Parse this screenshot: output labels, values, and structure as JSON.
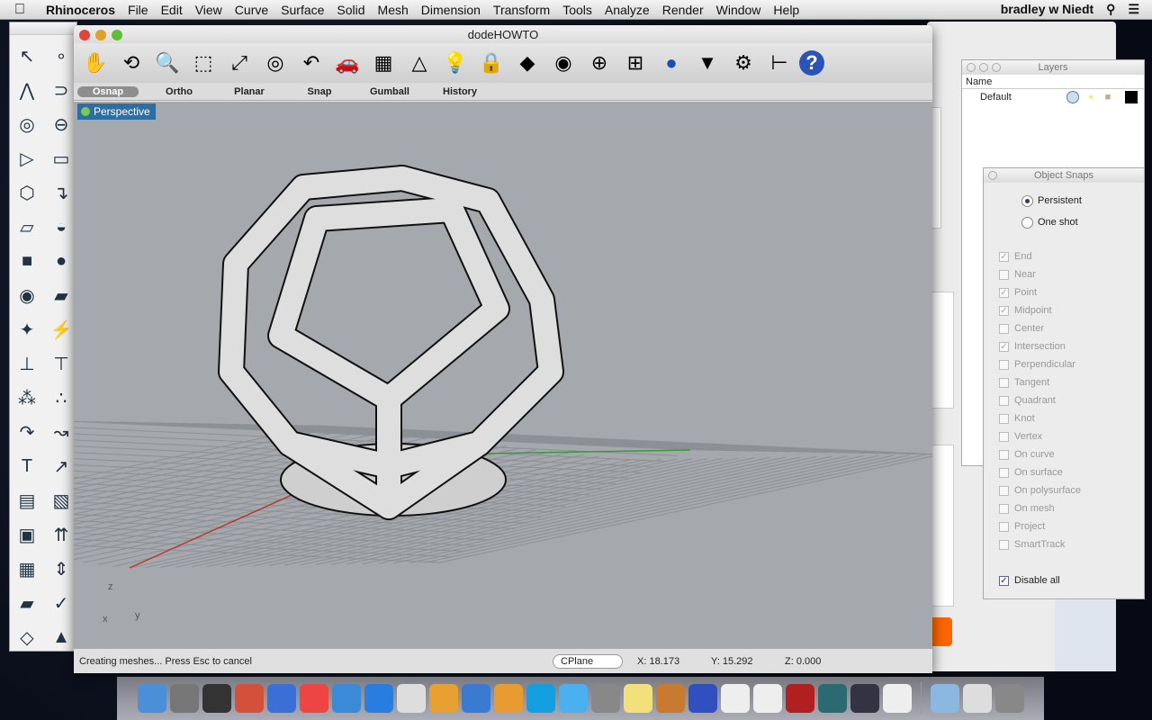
{
  "menubar": {
    "app": "Rhinoceros",
    "items": [
      "File",
      "Edit",
      "View",
      "Curve",
      "Surface",
      "Solid",
      "Mesh",
      "Dimension",
      "Transform",
      "Tools",
      "Analyze",
      "Render",
      "Window",
      "Help"
    ],
    "user": "bradley w Niedt"
  },
  "window": {
    "title": "dodeHOWTO"
  },
  "toolbar": {
    "icons": [
      "pan-hand-icon",
      "rotate-view-icon",
      "zoom-dynamic-icon",
      "zoom-window-icon",
      "zoom-extents-icon",
      "zoom-selected-icon",
      "undo-view-icon",
      "named-view-car-icon",
      "cplane-icon",
      "shapes-icon",
      "light-icon",
      "lock-icon",
      "layer-icon",
      "color-wheel-icon",
      "wireframe-sphere-icon",
      "grid-sphere-icon",
      "shaded-sphere-icon",
      "render-cone-icon",
      "gear-options-icon",
      "dimension-icon",
      "help-icon"
    ]
  },
  "modes": {
    "items": [
      "Osnap",
      "Ortho",
      "Planar",
      "Snap",
      "Gumball",
      "History"
    ],
    "active": "Osnap"
  },
  "viewport": {
    "name": "Perspective",
    "axis_z": "z",
    "axis_x": "x",
    "axis_y": "y"
  },
  "status": {
    "message": "Creating meshes... Press Esc to cancel",
    "cplane": "CPlane",
    "x": "X: 18.173",
    "y": "Y: 15.292",
    "z": "Z: 0.000"
  },
  "layers": {
    "title": "Layers",
    "header": "Name",
    "rows": [
      {
        "name": "Default",
        "color": "#000000"
      }
    ]
  },
  "object_snaps": {
    "title": "Object Snaps",
    "modes": [
      {
        "label": "Persistent",
        "selected": true
      },
      {
        "label": "One shot",
        "selected": false
      }
    ],
    "items": [
      {
        "label": "End",
        "checked": true
      },
      {
        "label": "Near",
        "checked": false
      },
      {
        "label": "Point",
        "checked": true
      },
      {
        "label": "Midpoint",
        "checked": true
      },
      {
        "label": "Center",
        "checked": false
      },
      {
        "label": "Intersection",
        "checked": true
      },
      {
        "label": "Perpendicular",
        "checked": false
      },
      {
        "label": "Tangent",
        "checked": false
      },
      {
        "label": "Quadrant",
        "checked": false
      },
      {
        "label": "Knot",
        "checked": false
      },
      {
        "label": "Vertex",
        "checked": false
      },
      {
        "label": "On curve",
        "checked": false
      },
      {
        "label": "On surface",
        "checked": false
      },
      {
        "label": "On polysurface",
        "checked": false
      },
      {
        "label": "On mesh",
        "checked": false
      },
      {
        "label": "Project",
        "checked": false
      },
      {
        "label": "SmartTrack",
        "checked": false
      }
    ],
    "disable_all": {
      "label": "Disable all",
      "checked": true
    }
  },
  "dock": {
    "icons": [
      "finder",
      "launchpad",
      "dashboard",
      "app",
      "itunes",
      "chrome",
      "safari",
      "app-store",
      "app",
      "app",
      "app",
      "app",
      "skype",
      "messages",
      "system-preferences",
      "stickies",
      "iphoto",
      "garageband",
      "calendar",
      "reminders",
      "photo-booth",
      "time-machine",
      "app",
      "solitaire",
      "documents-folder",
      "downloads",
      "trash"
    ]
  },
  "colors": {
    "x_axis": "#b33a2f",
    "y_axis": "#3a9a3a",
    "viewport_bg": "#a5a9ad",
    "active_tab": "#2f6ea0"
  }
}
